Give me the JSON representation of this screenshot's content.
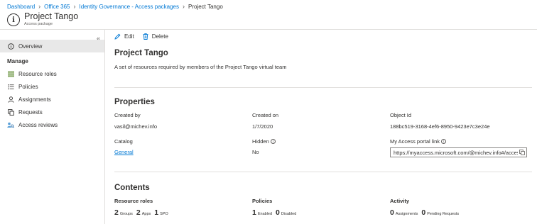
{
  "breadcrumb": [
    {
      "label": "Dashboard"
    },
    {
      "label": "Office 365"
    },
    {
      "label": "Identity Governance - Access packages"
    },
    {
      "label": "Project Tango"
    }
  ],
  "header": {
    "title": "Project Tango",
    "subtitle": "Access package",
    "icon": "info-icon"
  },
  "sidebar": {
    "collapse_glyph": "«",
    "overview": {
      "label": "Overview",
      "icon": "info-icon"
    },
    "manage_heading": "Manage",
    "items": [
      {
        "label": "Resource roles",
        "icon": "grid-icon"
      },
      {
        "label": "Policies",
        "icon": "list-icon"
      },
      {
        "label": "Assignments",
        "icon": "person-icon"
      },
      {
        "label": "Requests",
        "icon": "requests-icon"
      },
      {
        "label": "Access reviews",
        "icon": "review-icon"
      }
    ]
  },
  "toolbar": {
    "edit_label": "Edit",
    "delete_label": "Delete"
  },
  "main": {
    "name": "Project Tango",
    "description": "A set of resources required by members of the Project Tango virtual team",
    "properties_heading": "Properties",
    "properties": {
      "created_by_label": "Created by",
      "created_by_value": "vasil@michev.info",
      "created_on_label": "Created on",
      "created_on_value": "1/7/2020",
      "object_id_label": "Object Id",
      "object_id_value": "188bc519-3168-4ef6-8950-9423e7c3e24e",
      "catalog_label": "Catalog",
      "catalog_value": "General",
      "hidden_label": "Hidden",
      "hidden_value": "No",
      "portal_link_label": "My Access portal link",
      "portal_link_value": "https://myaccess.microsoft.com/@michev.info#/access-packages/..."
    },
    "contents_heading": "Contents",
    "contents": {
      "resource_roles": {
        "label": "Resource roles",
        "stats": [
          {
            "value": "2",
            "unit": "Groups"
          },
          {
            "value": "2",
            "unit": "Apps"
          },
          {
            "value": "1",
            "unit": "SPO"
          }
        ]
      },
      "policies": {
        "label": "Policies",
        "stats": [
          {
            "value": "1",
            "unit": "Enabled"
          },
          {
            "value": "0",
            "unit": "Disabled"
          }
        ]
      },
      "activity": {
        "label": "Activity",
        "stats": [
          {
            "value": "0",
            "unit": "Assignments"
          },
          {
            "value": "0",
            "unit": "Pending Requests"
          }
        ]
      }
    }
  },
  "colors": {
    "link": "#0078d4",
    "text": "#323130",
    "active_nav_bg": "#e8e8e8"
  }
}
